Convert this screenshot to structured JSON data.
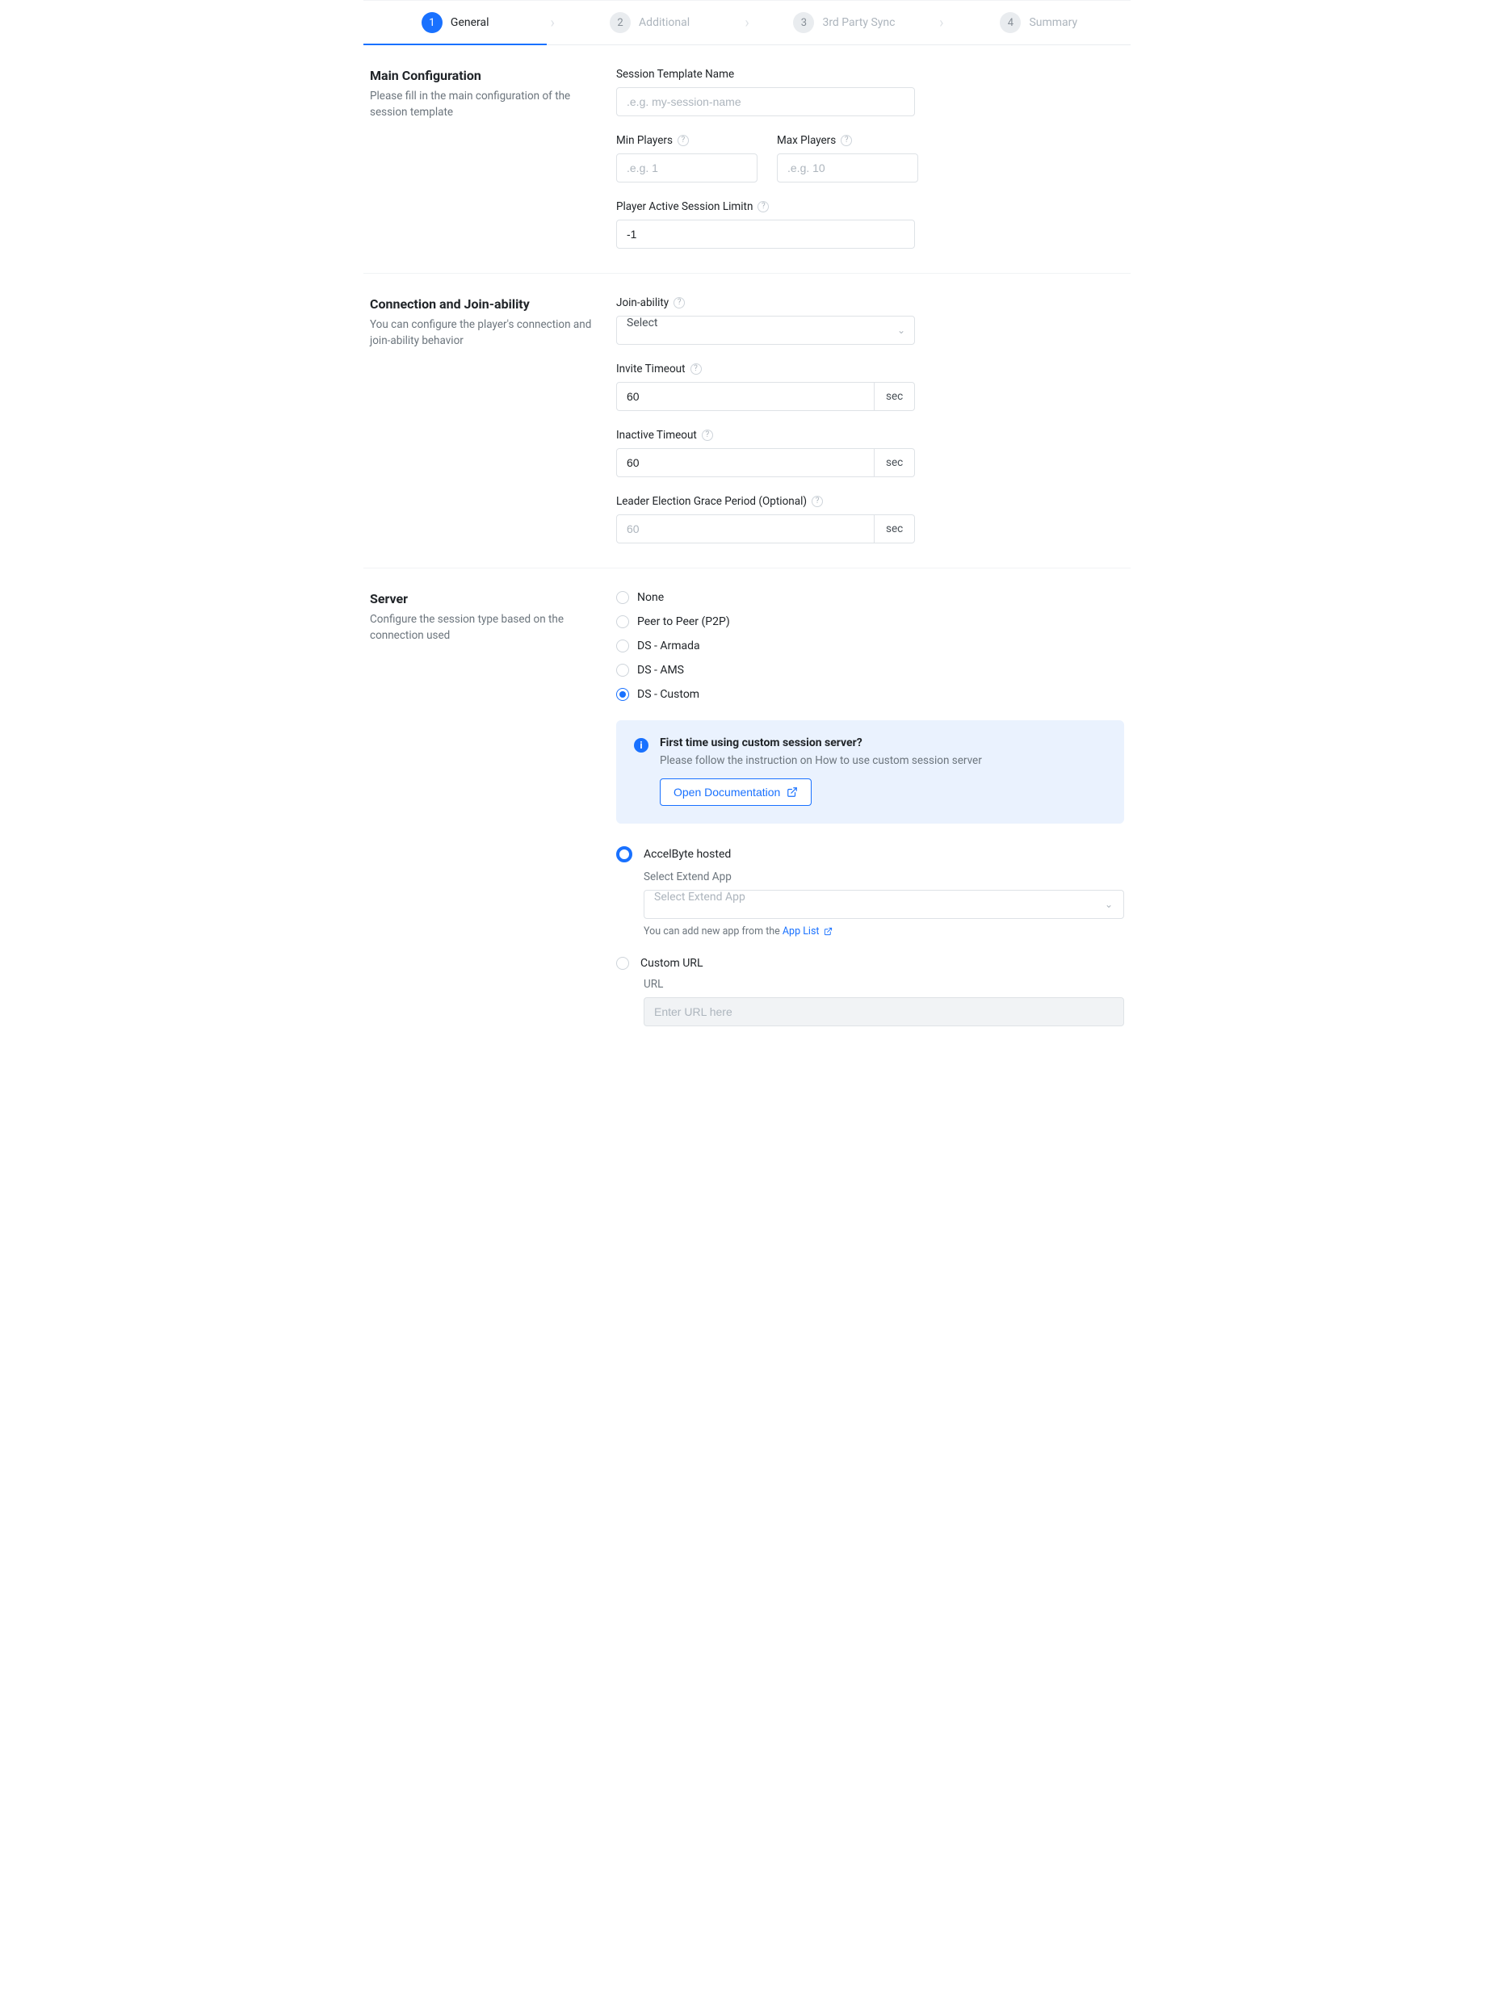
{
  "stepper": {
    "steps": [
      {
        "num": "1",
        "label": "General",
        "active": true
      },
      {
        "num": "2",
        "label": "Additional",
        "active": false
      },
      {
        "num": "3",
        "label": "3rd Party Sync",
        "active": false
      },
      {
        "num": "4",
        "label": "Summary",
        "active": false
      }
    ]
  },
  "sections": {
    "main": {
      "title": "Main Configuration",
      "desc": "Please fill in the main configuration of the session template",
      "templateName": {
        "label": "Session Template Name",
        "placeholder": ".e.g. my-session-name",
        "value": ""
      },
      "minPlayers": {
        "label": "Min Players",
        "placeholder": ".e.g. 1",
        "value": ""
      },
      "maxPlayers": {
        "label": "Max Players",
        "placeholder": ".e.g. 10",
        "value": ""
      },
      "activeLimit": {
        "label": "Player Active Session Limitn",
        "value": "-1"
      }
    },
    "conn": {
      "title": "Connection and Join-ability",
      "desc": "You can configure the player's connection and join-ability behavior",
      "joinability": {
        "label": "Join-ability",
        "placeholder": "Select"
      },
      "inviteTimeout": {
        "label": "Invite Timeout",
        "value": "60",
        "unit": "sec"
      },
      "inactiveTimeout": {
        "label": "Inactive Timeout",
        "value": "60",
        "unit": "sec"
      },
      "leaderGrace": {
        "label": "Leader Election Grace Period (Optional)",
        "placeholder": "60",
        "unit": "sec"
      }
    },
    "server": {
      "title": "Server",
      "desc": "Configure the session type based on the connection used",
      "types": {
        "none": "None",
        "p2p": "Peer to Peer (P2P)",
        "armada": "DS - Armada",
        "ams": "DS - AMS",
        "custom": "DS - Custom"
      },
      "info": {
        "title": "First time using custom session server?",
        "text": "Please follow the instruction on How to use custom session server",
        "button": "Open Documentation"
      },
      "host": {
        "accelbyte": {
          "label": "AccelByte hosted",
          "sublabel": "Select Extend App",
          "placeholder": "Select Extend App",
          "helper": "You can add new app from the ",
          "link": "App List"
        },
        "custom": {
          "label": "Custom URL",
          "sublabel": "URL",
          "placeholder": "Enter URL here"
        }
      }
    }
  }
}
